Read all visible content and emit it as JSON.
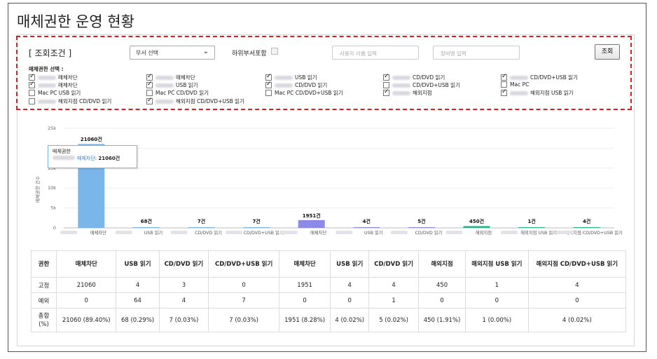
{
  "page": {
    "title": "매체권한 운영 현황"
  },
  "filter": {
    "title": "[ 조회조건 ]",
    "dept_select": "부서 선택",
    "sub_dept_label": "하위부서포함",
    "user_placeholder": "사용자 이름 입력",
    "equip_placeholder": "장비명 입력",
    "search_button": "조회",
    "selection_label": "매체권한 선택 :",
    "options": [
      {
        "label": "매체차단",
        "checked": true
      },
      {
        "label": "매체차단",
        "checked": true
      },
      {
        "label": "USB 읽기",
        "checked": true
      },
      {
        "label": "CD/DVD 읽기",
        "checked": true
      },
      {
        "label": "CD/DVD+USB 읽기",
        "checked": true
      },
      {
        "label": "매체차단",
        "checked": true
      },
      {
        "label": "USB 읽기",
        "checked": true
      },
      {
        "label": "CD/DVD 읽기",
        "checked": true
      },
      {
        "label": "CD/DVD+USB 읽기",
        "checked": false
      },
      {
        "label": "Mac PC",
        "checked": false
      },
      {
        "label": "Mac PC USB 읽기",
        "checked": false
      },
      {
        "label": "Mac PC CD/DVD 읽기",
        "checked": false
      },
      {
        "label": "Mac PC CD/DVD+USB 읽기",
        "checked": false
      },
      {
        "label": "해외지점",
        "checked": true
      },
      {
        "label": "해외지점 USB 읽기",
        "checked": true
      },
      {
        "label": "해외지점 CD/DVD 읽기",
        "checked": false
      },
      {
        "label": "해외지점 CD/DVD+USB 읽기",
        "checked": true
      }
    ]
  },
  "chart_data": {
    "type": "bar",
    "categories": [
      "매체차단",
      "USB 읽기",
      "CD/DVD 읽기",
      "CD/DVD+USB 읽기",
      "매체차단",
      "USB 읽기",
      "CD/DVD 읽기",
      "해외지점",
      "해외지점 USB 읽기",
      "해외지점 CD/DVD+USB 읽기"
    ],
    "values": [
      21060,
      68,
      7,
      7,
      1951,
      4,
      5,
      450,
      1,
      4
    ],
    "value_labels": [
      "21060건",
      "68건",
      "7건",
      "7건",
      "1951건",
      "4건",
      "5건",
      "450건",
      "1건",
      "4건"
    ],
    "tick_labels_x": [
      "매체차단",
      "USB 읽기",
      "CD/DVD 읽기",
      "CD/DVD+USB 읽기",
      "매체차단",
      "USB 읽기",
      "CD/DVD 읽기",
      "해외지점",
      "해외지점 USB 읽기",
      "해외지점 CD/DVD+USB 읽기"
    ],
    "yticks": [
      "25k",
      "20k",
      "15k",
      "10k",
      "5k",
      "0"
    ],
    "ylim": [
      0,
      25000
    ],
    "ylabel": "매체권한 건수",
    "bar_colors": [
      "#7ab6ea",
      "#7ab6ea",
      "#7ab6ea",
      "#7ab6ea",
      "#8a8ae8",
      "#8a8ae8",
      "#8a8ae8",
      "#2ab38a",
      "#2ab38a",
      "#2ab38a"
    ],
    "tooltip": {
      "title": "매체권한",
      "series": "매체차단",
      "value": "21060건"
    }
  },
  "table": {
    "headers": [
      "권한",
      "매체차단",
      "USB 읽기",
      "CD/DVD 읽기",
      "CD/DVD+USB 읽기",
      "매체차단",
      "USB 읽기",
      "CD/DVD 읽기",
      "해외지점",
      "해외지점 USB 읽기",
      "해외지점 CD/DVD+USB 읽기"
    ],
    "rows": [
      [
        "고정",
        "21060",
        "4",
        "3",
        "0",
        "1951",
        "4",
        "4",
        "450",
        "1",
        "4"
      ],
      [
        "예외",
        "0",
        "64",
        "4",
        "7",
        "0",
        "0",
        "1",
        "0",
        "0",
        "0"
      ],
      [
        "총합 (%)",
        "21060 (89.40%)",
        "68 (0.29%)",
        "7 (0.03%)",
        "7 (0.03%)",
        "1951 (8.28%)",
        "4 (0.02%)",
        "5 (0.02%)",
        "450 (1.91%)",
        "1 (0.00%)",
        "4 (0.02%)"
      ]
    ]
  }
}
